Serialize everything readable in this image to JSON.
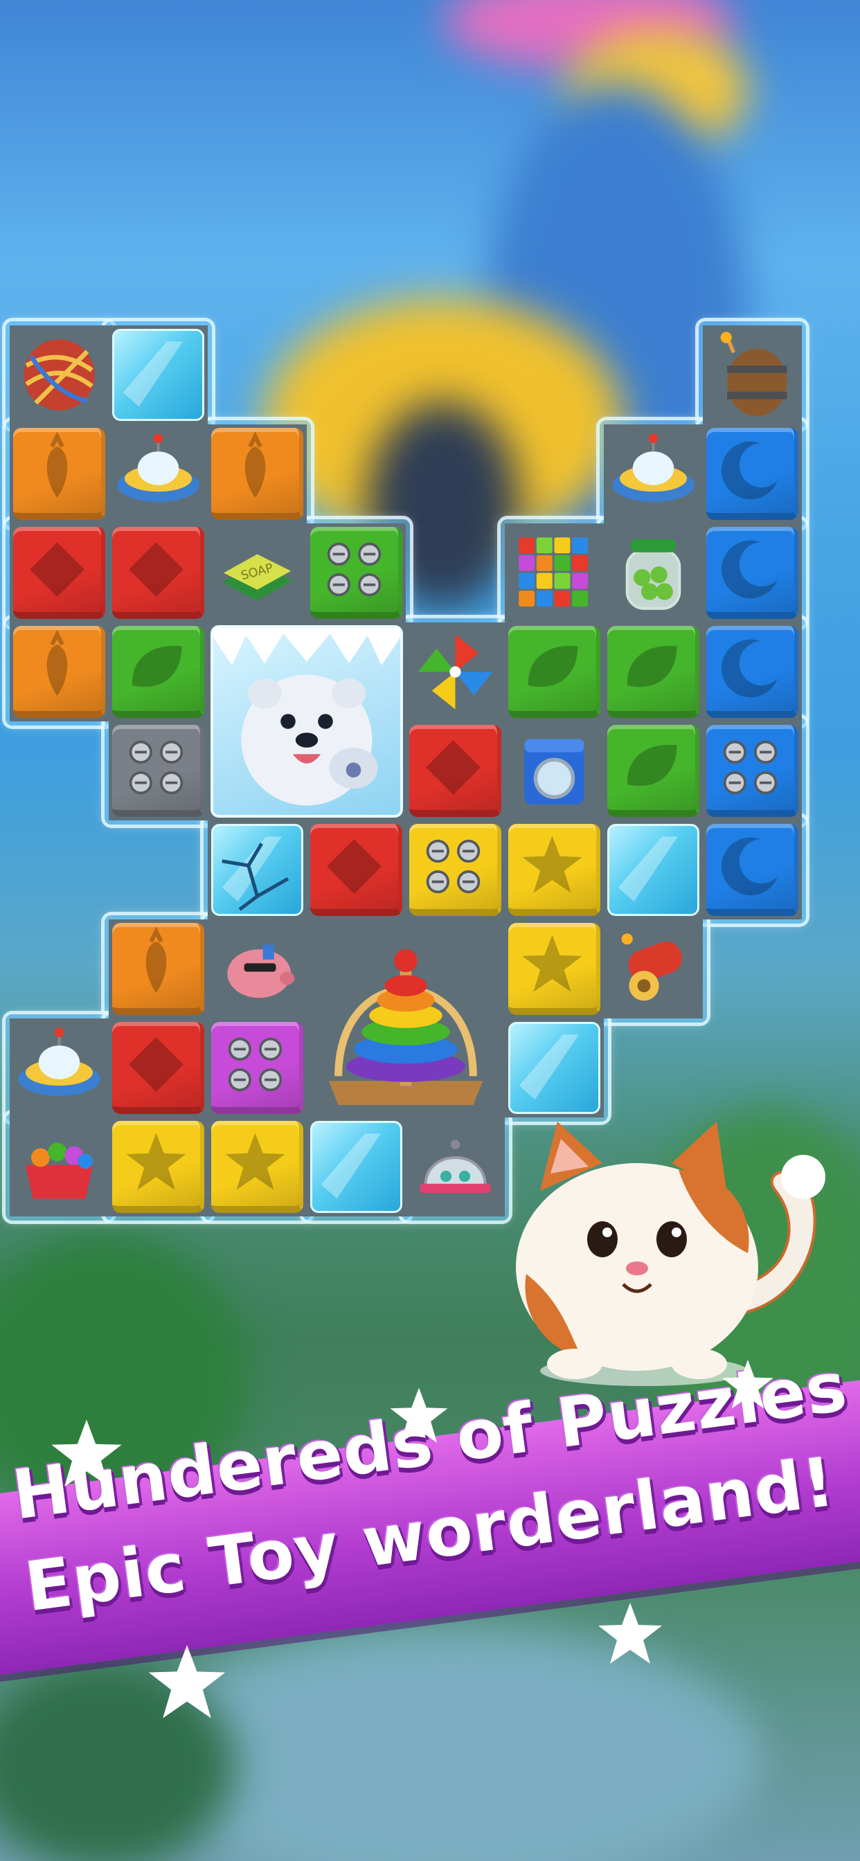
{
  "promo": {
    "headline_line1": "Hundereds of Puzzles",
    "headline_line2": "Epic Toy worderland!"
  },
  "colors": {
    "banner": "#b23dd0",
    "headline_text": "#ffffff",
    "headline_shadow": "#6f1a93",
    "board_frame": "#78cdff",
    "cell_background": "#5f6f78"
  },
  "board": {
    "rows": [
      [
        "yarn-ball-icon",
        "ice-cube",
        "",
        "",
        "",
        "",
        "",
        "barrel-bomb-icon"
      ],
      [
        "orange-carrot-cube",
        "ufo-toy-icon",
        "orange-carrot-cube",
        "",
        "",
        "",
        "ufo-toy-icon",
        "blue-moon-cube"
      ],
      [
        "red-diamond-cube",
        "red-diamond-cube",
        "soap-bar-icon",
        "green-dots-cube",
        "",
        "rubik-cube-icon",
        "candy-jar-icon",
        "blue-moon-cube"
      ],
      [
        "orange-carrot-cube",
        "green-leaf-cube",
        "polar-bear-icon",
        "polar-bear-icon",
        "pinwheel-icon",
        "green-leaf-cube",
        "green-leaf-cube",
        "blue-moon-cube"
      ],
      [
        "",
        "steel-dots-cube",
        "polar-bear-icon",
        "polar-bear-icon",
        "red-diamond-cube",
        "washing-machine-icon",
        "green-leaf-cube",
        "blue-dots-cube"
      ],
      [
        "",
        "",
        "cracked-ice-cube",
        "red-diamond-cube",
        "yellow-dots-cube",
        "yellow-star-cube",
        "ice-cube",
        "blue-moon-cube"
      ],
      [
        "",
        "orange-carrot-cube",
        "piggy-bank-icon",
        "stacking-rings-icon",
        "stacking-rings-icon",
        "yellow-star-cube",
        "cannon-icon",
        ""
      ],
      [
        "ufo-toy-icon",
        "red-diamond-cube",
        "purple-dots-cube",
        "stacking-rings-icon",
        "stacking-rings-icon",
        "ice-cube",
        "",
        ""
      ],
      [
        "fruit-basket-icon",
        "yellow-star-cube",
        "yellow-star-cube",
        "ice-cube",
        "bell-dome-icon",
        "",
        "",
        ""
      ]
    ]
  },
  "mascot": "cat-mascot-icon",
  "decorations": [
    "star-icon",
    "star-icon",
    "star-icon",
    "star-icon",
    "star-icon"
  ]
}
